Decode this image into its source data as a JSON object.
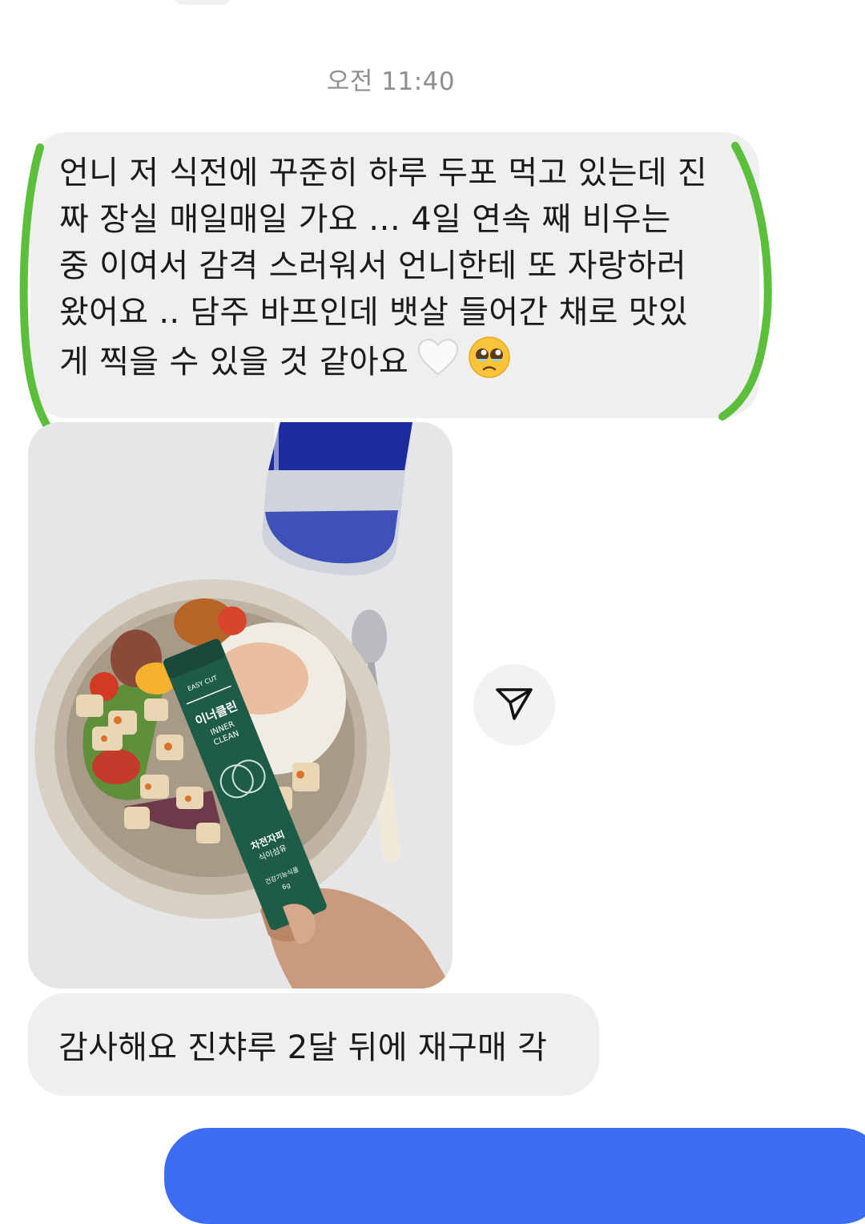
{
  "thread": {
    "timestamp": "오전 11:40",
    "received_message_1": {
      "lines": [
        "언니 저 식전에 꾸준히 하루 두포 먹고 있는데 진",
        "짜 장실 매일매일 가요 …  4일 연속 째 비우는",
        "중 이여서 감격 스러워서 언니한테 또 자랑하러",
        "왔어요 .. 담주 바프인데 뱃살 들어간 채로 맛있",
        "게 찍을 수 있을 것 같아요"
      ],
      "emojis": [
        "white-heart-icon",
        "pleading-face-icon"
      ]
    },
    "photo": {
      "product_brand": "EASY CUT",
      "product_name_ko": "이너클린",
      "product_name_en_1": "INNER",
      "product_name_en_2": "CLEAN",
      "product_flavor_ko": "차전자피",
      "product_flavor_sub": "식이섬유",
      "product_type": "건강기능식품",
      "product_weight": "6g"
    },
    "received_message_2": "감사해요 진챠루 2달 뒤에 재구매 각",
    "share_icon": "paper-plane-icon"
  },
  "colors": {
    "bubble_bg": "#efefef",
    "timestamp": "#8e8e8e",
    "highlight_green": "#5bbf3c",
    "sent_blue": "#3d6df2",
    "product_green": "#1f5c48"
  }
}
